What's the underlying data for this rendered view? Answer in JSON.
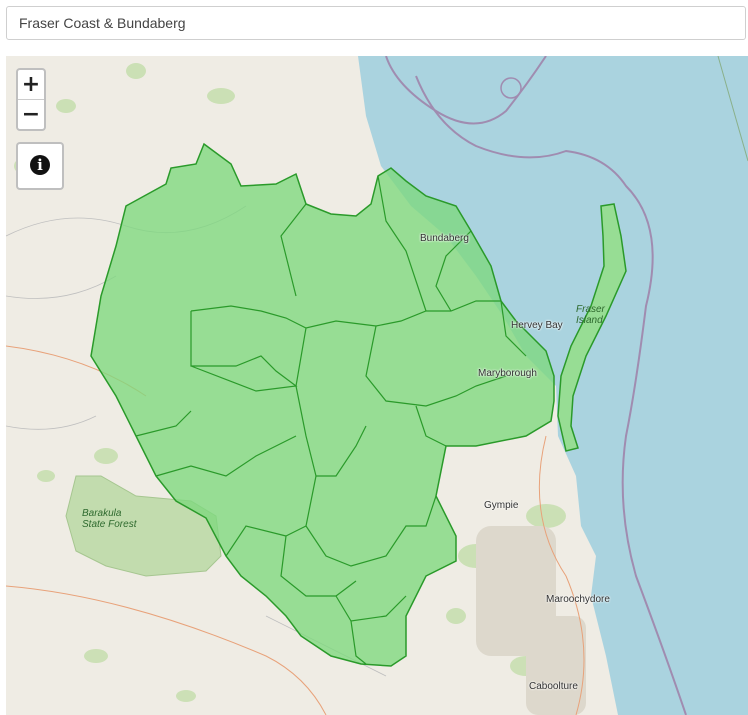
{
  "region_selector": {
    "value": "Fraser Coast & Bundaberg"
  },
  "map": {
    "zoom_in_label": "+",
    "zoom_out_label": "−",
    "info_icon": "info-circle-icon",
    "highlight_color": "#7dd97d",
    "highlight_border": "#2a9a2a",
    "water_color": "#aad3df",
    "place_labels": {
      "bundaberg": "Bundaberg",
      "hervey_bay": "Hervey Bay",
      "fraser_island": "Fraser\nIsland",
      "maryborough": "Maryborough",
      "gympie": "Gympie",
      "barakula_state_forest": "Barakula\nState Forest",
      "maroochydore": "Maroochydore",
      "caboolture": "Caboolture"
    }
  }
}
